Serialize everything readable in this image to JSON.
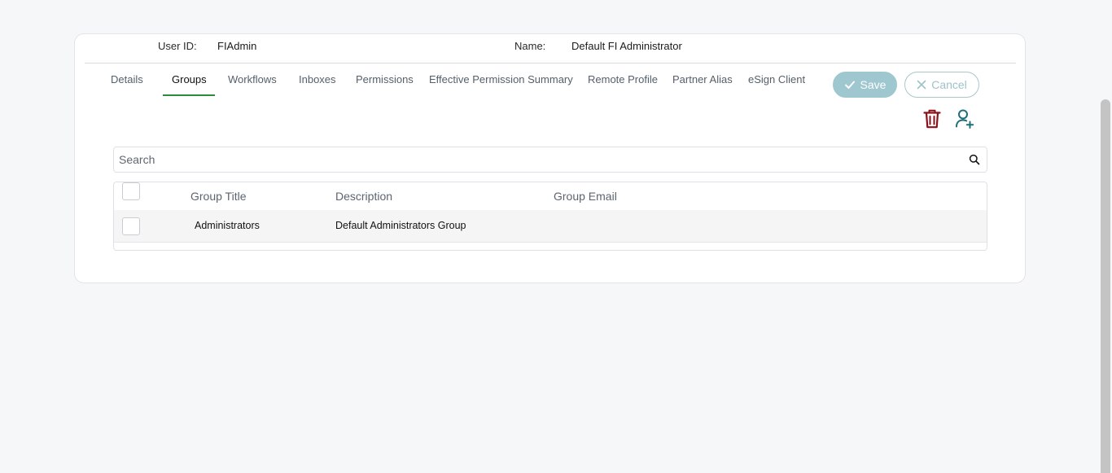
{
  "header": {
    "user_id_label": "User ID:",
    "user_id_value": "FIAdmin",
    "name_label": "Name:",
    "name_value": "Default FI Administrator"
  },
  "tabs": [
    {
      "label": "Details",
      "active": false
    },
    {
      "label": "Groups",
      "active": true
    },
    {
      "label": "Workflows",
      "active": false
    },
    {
      "label": "Inboxes",
      "active": false
    },
    {
      "label": "Permissions",
      "active": false
    },
    {
      "label": "Effective Permission Summary",
      "active": false
    },
    {
      "label": "Remote Profile",
      "active": false
    },
    {
      "label": "Partner Alias",
      "active": false
    },
    {
      "label": "eSign Client",
      "active": false
    }
  ],
  "actions": {
    "save_label": "Save",
    "cancel_label": "Cancel",
    "delete_icon": "trash-icon",
    "add_user_icon": "user-plus-icon"
  },
  "search": {
    "placeholder": "Search",
    "icon": "search-icon"
  },
  "table": {
    "columns": [
      "Group Title",
      "Description",
      "Group Email"
    ],
    "rows": [
      {
        "title": "Administrators",
        "description": "Default Administrators Group",
        "email": ""
      }
    ]
  },
  "colors": {
    "accent": "#2e8b3a",
    "save_button": "#9fc7cf",
    "delete_icon": "#8b1018",
    "add_user_icon": "#1c6f7a"
  }
}
